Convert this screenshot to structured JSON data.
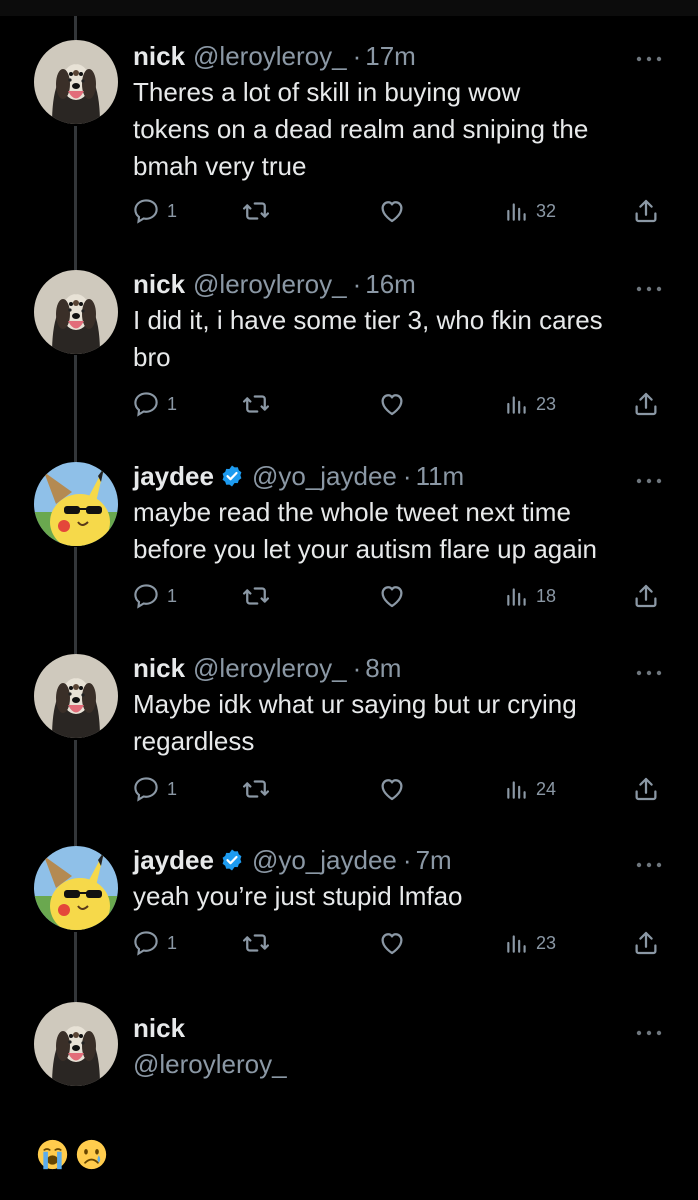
{
  "tweets": [
    {
      "name": "nick",
      "handle": "@leroyleroy_",
      "time": "17m",
      "verified": false,
      "avatar": "dog-avatar",
      "text": [
        "Theres a lot of skill in buying wow",
        "tokens on a dead realm and sniping the",
        "bmah very true"
      ],
      "replies": "1",
      "retweets": "",
      "likes": "",
      "views": "32"
    },
    {
      "name": "nick",
      "handle": "@leroyleroy_",
      "time": "16m",
      "verified": false,
      "avatar": "dog-avatar",
      "text": [
        "I did it, i have some tier 3, who fkin cares",
        "bro"
      ],
      "replies": "1",
      "retweets": "",
      "likes": "",
      "views": "23"
    },
    {
      "name": "jaydee",
      "handle": "@yo_jaydee",
      "time": "11m",
      "verified": true,
      "avatar": "pikachu-avatar",
      "text": [
        "maybe read the whole tweet next time",
        "before you let your autism flare up again"
      ],
      "replies": "1",
      "retweets": "",
      "likes": "",
      "views": "18"
    },
    {
      "name": "nick",
      "handle": "@leroyleroy_",
      "time": "8m",
      "verified": false,
      "avatar": "dog-avatar",
      "text": [
        "Maybe idk what ur saying but ur crying",
        "regardless"
      ],
      "replies": "1",
      "retweets": "",
      "likes": "",
      "views": "24"
    },
    {
      "name": "jaydee",
      "handle": "@yo_jaydee",
      "time": "7m",
      "verified": true,
      "avatar": "pikachu-avatar",
      "text": [
        "yeah you’re just stupid lmfao"
      ],
      "replies": "1",
      "retweets": "",
      "likes": "",
      "views": "23"
    }
  ],
  "focused_tweet": {
    "name": "nick",
    "handle": "@leroyleroy_",
    "emojis": [
      "loudly-crying-face",
      "crying-face"
    ]
  },
  "colors": {
    "background": "#000000",
    "text": "#e7e9ea",
    "secondary": "#8b98a5",
    "verified_blue": "#1d9bf0",
    "thread_line": "#333639"
  },
  "middle_dot": "·"
}
